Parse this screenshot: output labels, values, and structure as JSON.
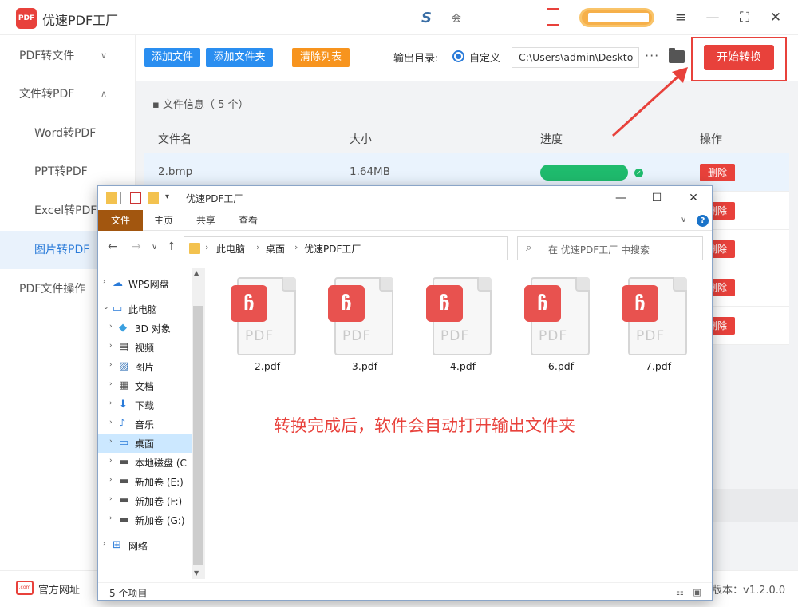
{
  "app": {
    "title": "优速PDF工厂",
    "logo_text": "PDF",
    "center_logo": "S",
    "center_text": "会"
  },
  "colors": {
    "accent": "#e8413b",
    "blue": "#2a7bd9",
    "orange": "#f7941e",
    "green": "#1fbb6d"
  },
  "sidebar": {
    "items": [
      {
        "label": "PDF转文件",
        "chevron": "chevron-down-icon"
      },
      {
        "label": "文件转PDF",
        "chevron": "chevron-up-icon"
      },
      {
        "label": "Word转PDF"
      },
      {
        "label": "PPT转PDF"
      },
      {
        "label": "Excel转PDF"
      },
      {
        "label": "图片转PDF",
        "active": true
      },
      {
        "label": "PDF文件操作"
      }
    ]
  },
  "toolbar": {
    "add_file": "添加文件",
    "add_folder": "添加文件夹",
    "clear_list": "清除列表",
    "output_label": "输出目录:",
    "custom_label": "自定义",
    "output_path": "C:\\Users\\admin\\Deskto",
    "more": "···",
    "start": "开始转换"
  },
  "file_info": {
    "label": "文件信息（ 5 个）"
  },
  "table": {
    "headers": [
      "文件名",
      "大小",
      "进度",
      "操作"
    ],
    "rows": [
      {
        "name": "2.bmp",
        "size": "1.64MB",
        "progress": 1.0,
        "action": "删除"
      },
      {
        "action": "删除"
      },
      {
        "action": "删除"
      },
      {
        "action": "删除"
      },
      {
        "action": "删除"
      }
    ]
  },
  "footer": {
    "site_icon_text": ".com",
    "site_link": "官方网址",
    "version": "版本：v1.2.0.0"
  },
  "explorer": {
    "title": "优速PDF工厂",
    "ribbon_tabs": [
      "文件",
      "主页",
      "共享",
      "查看"
    ],
    "breadcrumb": [
      "此电脑",
      "桌面",
      "优速PDF工厂"
    ],
    "search_placeholder": "在 优速PDF工厂 中搜索",
    "tree": [
      {
        "label": "WPS网盘",
        "icon": "cloud-icon",
        "indent": 0,
        "arrow": "›"
      },
      {
        "label": "此电脑",
        "icon": "computer-icon",
        "indent": 0,
        "arrow": "⌄"
      },
      {
        "label": "3D 对象",
        "icon": "cube-icon",
        "indent": 1,
        "arrow": "›"
      },
      {
        "label": "视频",
        "icon": "video-icon",
        "indent": 1,
        "arrow": "›"
      },
      {
        "label": "图片",
        "icon": "picture-icon",
        "indent": 1,
        "arrow": "›"
      },
      {
        "label": "文档",
        "icon": "document-icon",
        "indent": 1,
        "arrow": "›"
      },
      {
        "label": "下载",
        "icon": "download-icon",
        "indent": 1,
        "arrow": "›"
      },
      {
        "label": "音乐",
        "icon": "music-icon",
        "indent": 1,
        "arrow": "›"
      },
      {
        "label": "桌面",
        "icon": "desktop-icon",
        "indent": 1,
        "arrow": "›",
        "selected": true
      },
      {
        "label": "本地磁盘 (C",
        "icon": "drive-icon",
        "indent": 1,
        "arrow": "›"
      },
      {
        "label": "新加卷 (E:)",
        "icon": "drive-icon",
        "indent": 1,
        "arrow": "›"
      },
      {
        "label": "新加卷 (F:)",
        "icon": "drive-icon",
        "indent": 1,
        "arrow": "›"
      },
      {
        "label": "新加卷 (G:)",
        "icon": "drive-icon",
        "indent": 1,
        "arrow": "›"
      },
      {
        "label": "网络",
        "icon": "network-icon",
        "indent": 0,
        "arrow": "›"
      }
    ],
    "files": [
      {
        "name": "2.pdf"
      },
      {
        "name": "3.pdf"
      },
      {
        "name": "4.pdf"
      },
      {
        "name": "6.pdf"
      },
      {
        "name": "7.pdf"
      }
    ],
    "pdf_label": "PDF",
    "status": "5 个项目"
  },
  "annotation": "转换完成后，软件会自动打开输出文件夹"
}
